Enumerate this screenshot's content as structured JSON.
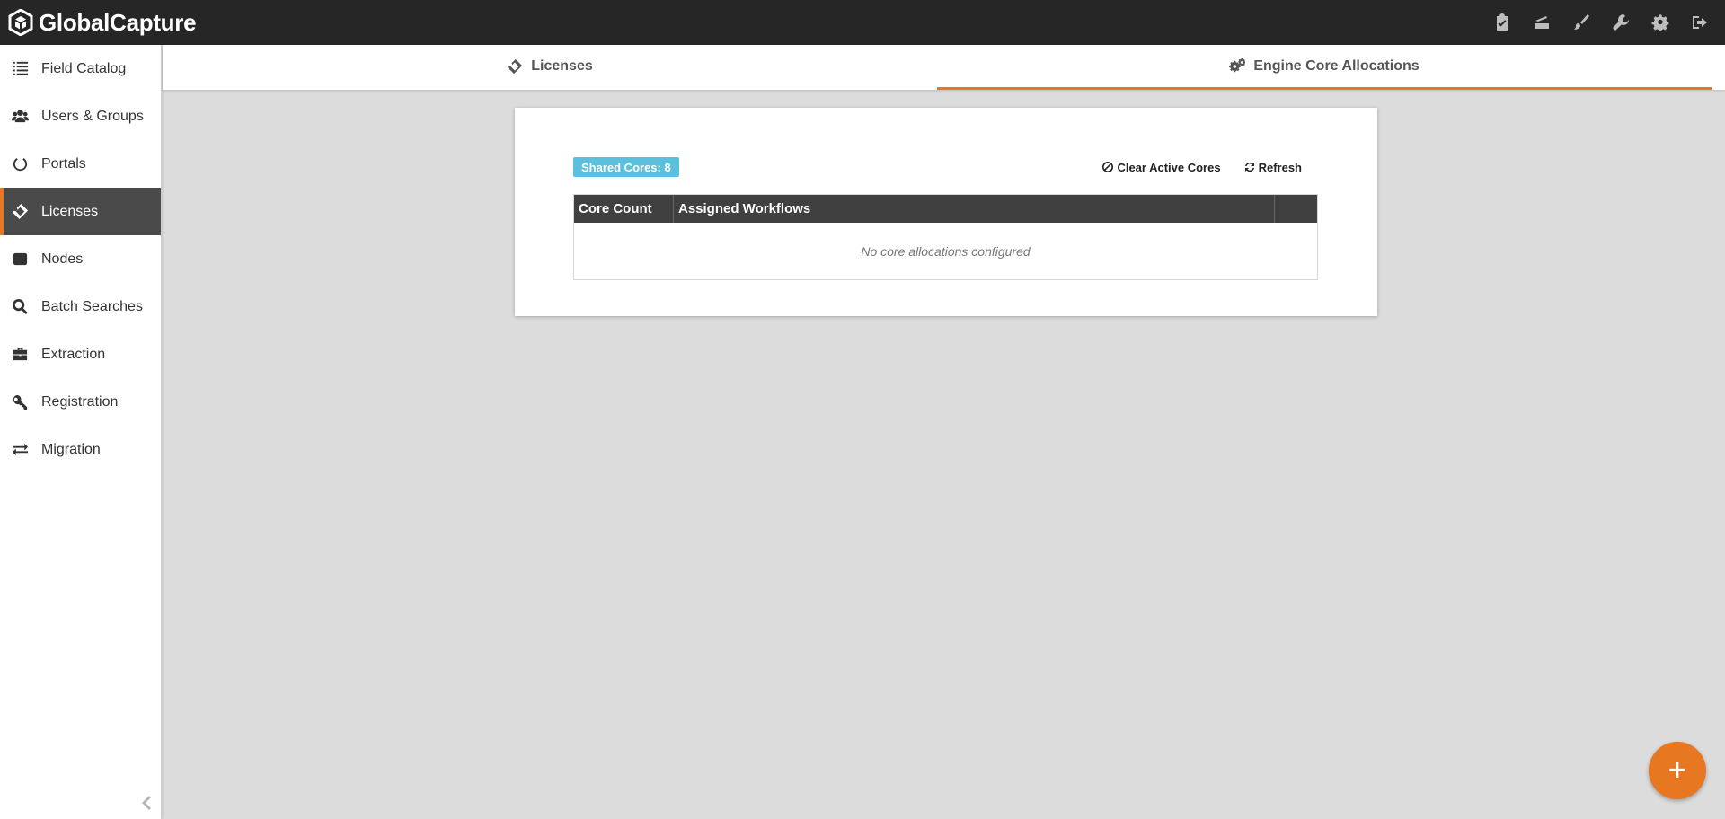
{
  "app": {
    "brand_name": "GlobalCapture"
  },
  "topbar": {
    "actions": [
      {
        "icon": "clipboard-check-icon"
      },
      {
        "icon": "scanner-icon"
      },
      {
        "icon": "brush-icon"
      },
      {
        "icon": "wrench-icon"
      },
      {
        "icon": "gear-icon"
      },
      {
        "icon": "sign-out-icon"
      }
    ]
  },
  "sidebar": {
    "items": [
      {
        "label": "Field Catalog",
        "icon": "list-icon"
      },
      {
        "label": "Users & Groups",
        "icon": "users-icon"
      },
      {
        "label": "Portals",
        "icon": "circle-notch-icon"
      },
      {
        "label": "Licenses",
        "icon": "ticket-icon",
        "active": true
      },
      {
        "label": "Nodes",
        "icon": "square-icon"
      },
      {
        "label": "Batch Searches",
        "icon": "search-icon"
      },
      {
        "label": "Extraction",
        "icon": "briefcase-icon"
      },
      {
        "label": "Registration",
        "icon": "key-icon"
      },
      {
        "label": "Migration",
        "icon": "exchange-icon"
      }
    ],
    "collapse_icon": "chevron-left-icon"
  },
  "tabs": [
    {
      "label": "Licenses",
      "icon": "ticket-icon",
      "active": false
    },
    {
      "label": "Engine Core Allocations",
      "icon": "cogs-icon",
      "active": true
    }
  ],
  "panel": {
    "badge": "Shared Cores: 8",
    "clear_label": "Clear Active Cores",
    "refresh_label": "Refresh",
    "table": {
      "columns": [
        "Core Count",
        "Assigned Workflows",
        ""
      ],
      "empty_message": "No core allocations configured"
    }
  },
  "fab": {
    "label": "+"
  },
  "colors": {
    "accent": "#e87722",
    "badge": "#5bc0de",
    "topbar": "#262626",
    "table_header": "#404040"
  }
}
